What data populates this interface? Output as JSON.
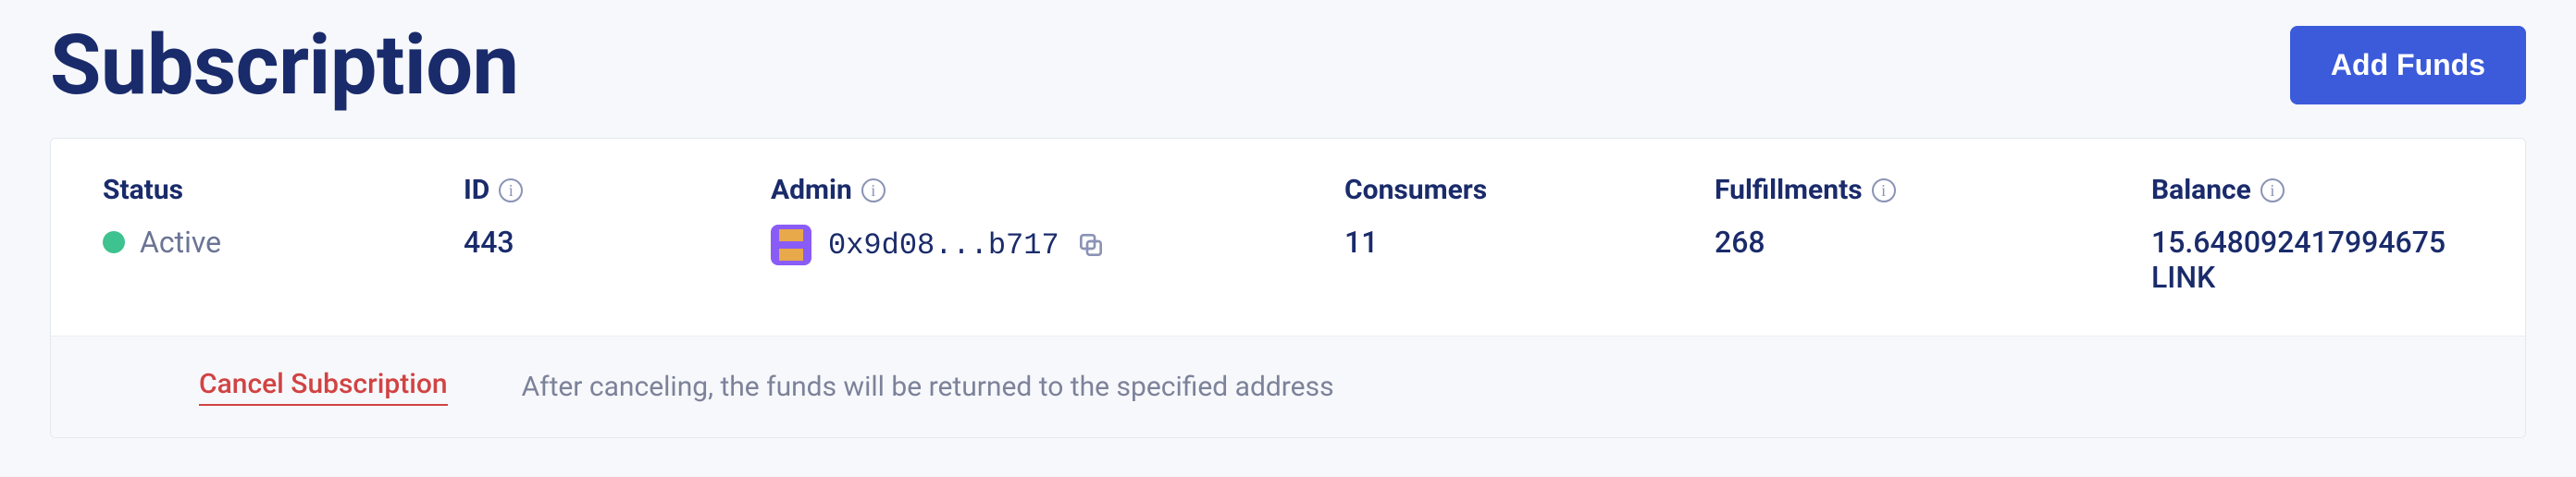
{
  "header": {
    "title": "Subscription",
    "add_funds_label": "Add Funds"
  },
  "fields": {
    "status": {
      "label": "Status",
      "value": "Active"
    },
    "id": {
      "label": "ID",
      "value": "443"
    },
    "admin": {
      "label": "Admin",
      "address": "0x9d08...b717"
    },
    "consumers": {
      "label": "Consumers",
      "value": "11"
    },
    "fulfillments": {
      "label": "Fulfillments",
      "value": "268"
    },
    "balance": {
      "label": "Balance",
      "value": "15.648092417994675 LINK"
    }
  },
  "footer": {
    "cancel_label": "Cancel Subscription",
    "cancel_desc": "After canceling, the funds will be returned to the specified address"
  }
}
